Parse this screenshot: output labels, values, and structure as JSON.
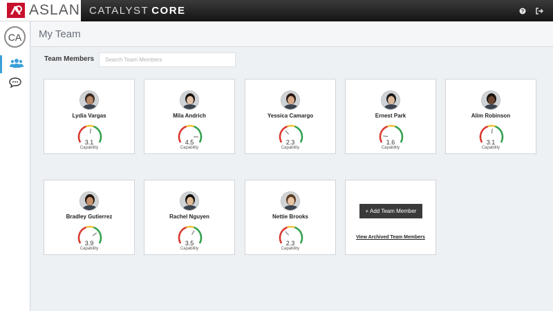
{
  "brand": {
    "name": "ASLAN",
    "logo_icon": "aslan-logo-icon",
    "accent": "#c8102e"
  },
  "product": {
    "light": "CATALYST",
    "bold": "CORE"
  },
  "topbar": {
    "icons": [
      "help-icon",
      "logout-icon"
    ]
  },
  "sidebar": {
    "avatar_initials": "CA",
    "items": [
      {
        "icon": "team-icon",
        "active": true
      },
      {
        "icon": "chat-icon",
        "active": false
      }
    ],
    "active_color": "#3aa0d8"
  },
  "header": {
    "title": "My Team"
  },
  "team": {
    "label": "Team Members",
    "search_placeholder": "Search Team Members",
    "capability_label": "Capability",
    "members": [
      {
        "name": "Lydia Vargas",
        "score": "3.1",
        "skin": "#b98a6a",
        "hair": "#3a2a20"
      },
      {
        "name": "Mila Andrich",
        "score": "4.5",
        "skin": "#e2c2a8",
        "hair": "#1c1410"
      },
      {
        "name": "Yessica Camargo",
        "score": "2.3",
        "skin": "#d6a98a",
        "hair": "#2a1a12"
      },
      {
        "name": "Ernest Park",
        "score": "1.6",
        "skin": "#d9b89a",
        "hair": "#1a1a1a"
      },
      {
        "name": "Alim Robinson",
        "score": "3.1",
        "skin": "#6a4632",
        "hair": "#1a120c"
      },
      {
        "name": "Bradley Gutierrez",
        "score": "3.9",
        "skin": "#c7946e",
        "hair": "#231710"
      },
      {
        "name": "Rachel Nguyen",
        "score": "3.5",
        "skin": "#e0bb98",
        "hair": "#14100c"
      },
      {
        "name": "Nettie Brooks",
        "score": "2.3",
        "skin": "#e6c4a4",
        "hair": "#5a3a22"
      }
    ],
    "add_button": "+ Add Team Member",
    "archived_link": "View Archived Team Members"
  },
  "gauge_colors": {
    "low": "#d9342b",
    "mid": "#f2c037",
    "high": "#2e9e4a"
  }
}
